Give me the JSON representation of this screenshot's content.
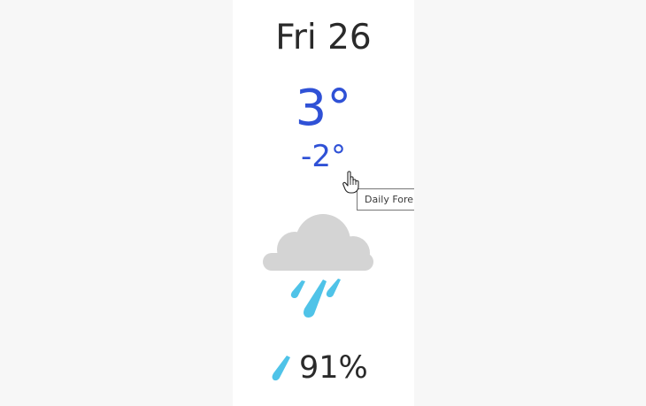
{
  "forecast_day": {
    "day_label": "Fri 26",
    "high_temp": "3°",
    "low_temp": "-2°",
    "condition_icon": "rain-cloud-icon",
    "precip_icon": "raindrop-icon",
    "precipitation": "91%"
  },
  "tooltip": {
    "text": "Daily Fore"
  },
  "colors": {
    "temperature": "#2f51d6",
    "cloud": "#d4d4d4",
    "rain": "#4fc3e8",
    "text": "#2a2a2a"
  }
}
